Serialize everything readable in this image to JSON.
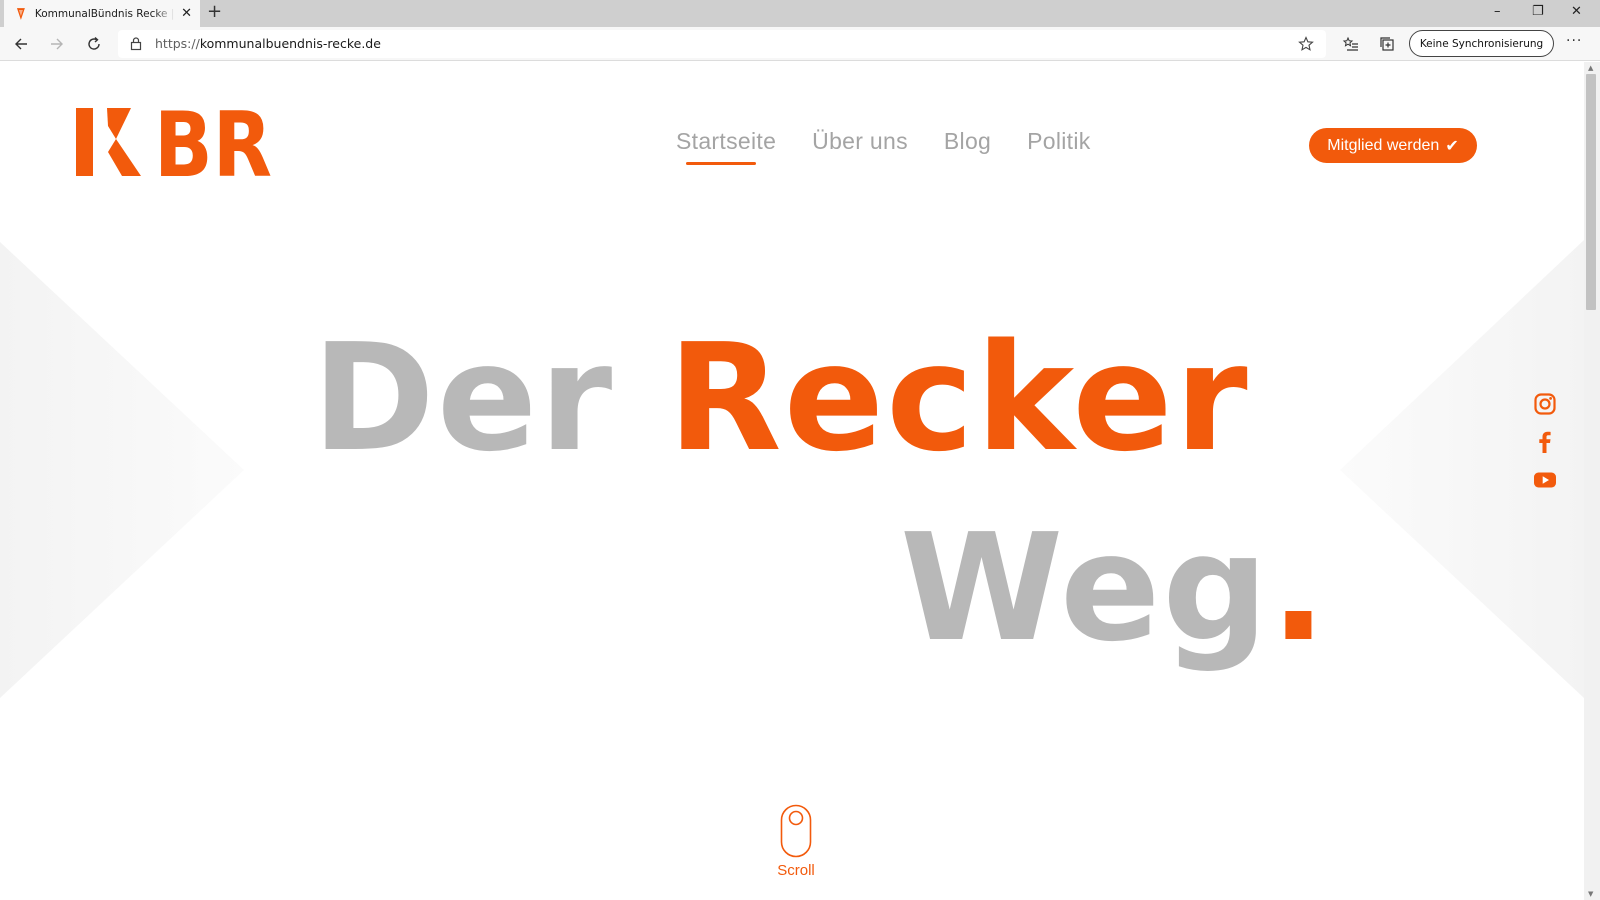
{
  "browser": {
    "tab_title": "KommunalBündnis Recke | ... weil",
    "tab_close": "✕",
    "new_tab": "+",
    "url_scheme": "https://",
    "url_host": "kommunalbuendnis-recke.de",
    "sync_label": "Keine Synchronisierung",
    "more": "···",
    "window": {
      "minimize": "–",
      "restore": "❐",
      "close": "✕"
    }
  },
  "site": {
    "logo_text": "KBR",
    "nav": [
      {
        "label": "Startseite",
        "active": true
      },
      {
        "label": "Über uns"
      },
      {
        "label": "Blog"
      },
      {
        "label": "Politik"
      }
    ],
    "cta_label": "Mitglied werden",
    "cta_check": "✔",
    "hero": {
      "word1": "Der",
      "word2": "Recker",
      "word3": "Weg",
      "dot": "."
    },
    "scroll_label": "Scroll",
    "socials": [
      "instagram-icon",
      "facebook-icon",
      "youtube-icon"
    ]
  },
  "colors": {
    "accent": "#f25a0c",
    "grey_text": "#b8b8b8",
    "nav_text": "#a4a4a4"
  }
}
